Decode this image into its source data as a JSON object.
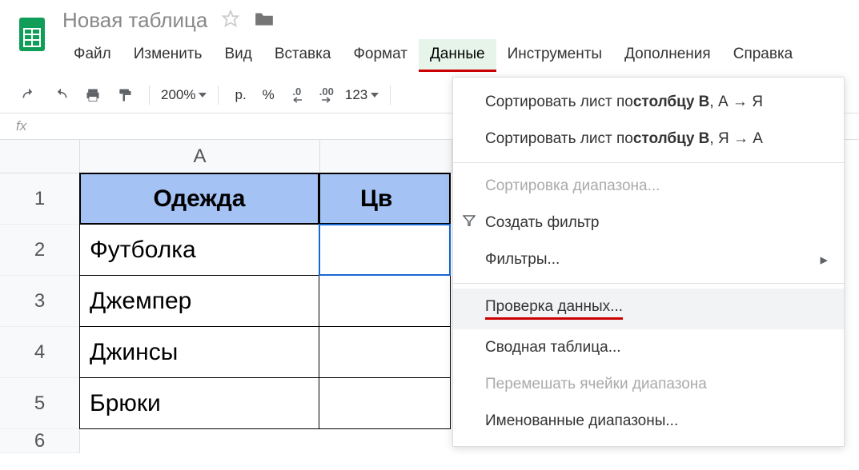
{
  "doc_title": "Новая таблица",
  "menubar": {
    "file": "Файл",
    "edit": "Изменить",
    "view": "Вид",
    "insert": "Вставка",
    "format": "Формат",
    "data": "Данные",
    "tools": "Инструменты",
    "addons": "Дополнения",
    "help": "Справка"
  },
  "toolbar": {
    "zoom": "200%",
    "currency": "р.",
    "percent": "%",
    "dec_decrease": ".0",
    "dec_increase": ".00",
    "more_formats": "123"
  },
  "columns": {
    "a": "A"
  },
  "rows": [
    "1",
    "2",
    "3",
    "4",
    "5",
    "6"
  ],
  "cells": {
    "a1": "Одежда",
    "b1_partial": "Цв",
    "a2": "Футболка",
    "a3": "Джемпер",
    "a4": "Джинсы",
    "a5": "Брюки"
  },
  "dropdown": {
    "sort_asc_prefix": "Сортировать лист по ",
    "sort_asc_bold": "столбцу B",
    "sort_asc_suffix": ", А → Я",
    "sort_desc_prefix": "Сортировать лист по ",
    "sort_desc_bold": "столбцу B",
    "sort_desc_suffix": ", Я → А",
    "sort_range": "Сортировка диапазона...",
    "create_filter": "Создать фильтр",
    "filters": "Фильтры...",
    "data_validation": "Проверка данных...",
    "pivot_table": "Сводная таблица...",
    "randomize": "Перемешать ячейки диапазона",
    "named_ranges": "Именованные диапазоны..."
  }
}
